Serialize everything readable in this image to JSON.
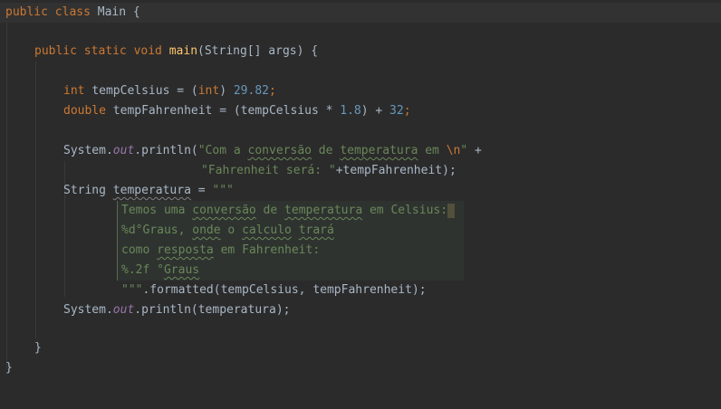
{
  "code": {
    "l1_kw": "public class ",
    "l1_name": "Main",
    "l1_rest": " {",
    "l3_mods": "public static void ",
    "l3_fn": "main",
    "l3_rest": "(String[] args) {",
    "l5_type": "int ",
    "l5_var": "tempCelsius = (",
    "l5_cast": "int",
    "l5_mid": ") ",
    "l5_num": "29.82",
    "l5_end": ";",
    "l6_type": "double ",
    "l6_var": "tempFahrenheit = (tempCelsius * ",
    "l6_num1": "1.8",
    "l6_mid": ") + ",
    "l6_num2": "32",
    "l6_end": ";",
    "l8_sys": "System.",
    "l8_out": "out",
    "l8_call": ".println(",
    "l8_str1": "\"Com a ",
    "l8_word1": "conversão",
    "l8_str2": " de ",
    "l8_word2": "temperatura",
    "l8_str3": " em ",
    "l8_esc": "\\n",
    "l8_str4": "\"",
    "l8_plus": " +",
    "l9_str": "\"Fahrenheit será: \"",
    "l9_rest": "+tempFahrenheit);",
    "l10_type": "String ",
    "l10_var": "temperatura",
    "l10_eq": " = ",
    "l10_quote": "\"\"\"",
    "l11_a": "Temos uma ",
    "l11_w1": "conversão",
    "l11_b": " de ",
    "l11_w2": "temperatura",
    "l11_c": " em Celsius:",
    "l12_a": "%d°Graus, ",
    "l12_w1": "onde",
    "l12_b": " o ",
    "l12_w2": "calculo",
    "l12_c": " ",
    "l12_w3": "trará",
    "l13_a": "como ",
    "l13_w1": "resposta",
    "l13_b": " em Fahrenheit:",
    "l14_a": "%.2f °",
    "l14_w1": "Graus",
    "l15_quote": "\"\"\"",
    "l15_rest": ".formatted(tempCelsius, tempFahrenheit);",
    "l16_sys": "System.",
    "l16_out": "out",
    "l16_rest": ".println(temperatura);",
    "l18": "}",
    "l19": "}"
  },
  "colors": {
    "background": "#2b2b2b",
    "keyword": "#cc7832",
    "function": "#ffc66d",
    "number": "#6897bb",
    "string": "#6a8759",
    "field": "#9876aa",
    "text": "#a9b7c6"
  }
}
